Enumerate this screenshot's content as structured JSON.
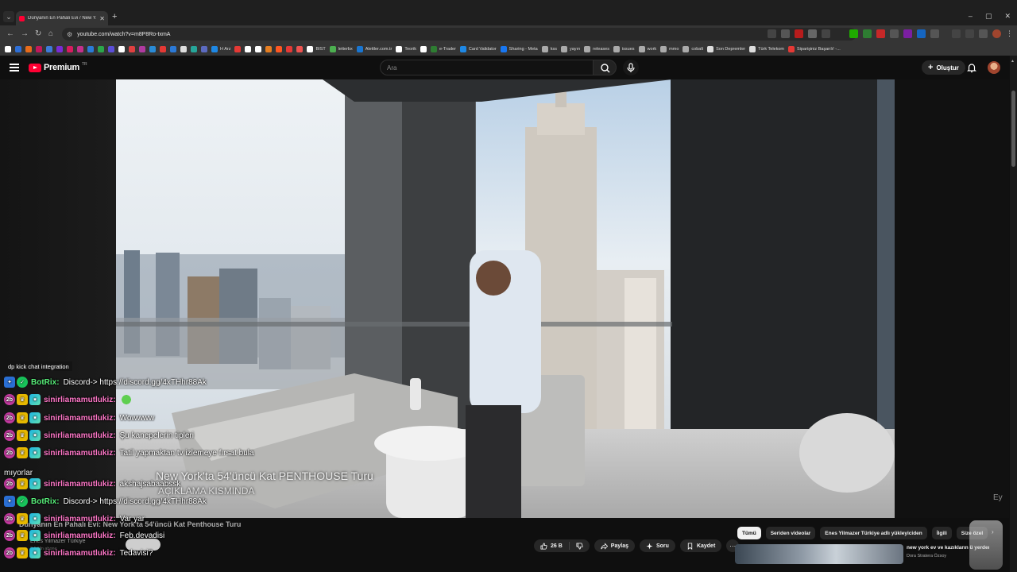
{
  "browser": {
    "tab_title": "Dünyanın En Pahalı Evi / New Y...",
    "tab_close": "✕",
    "new_tab": "+",
    "window_controls": [
      "–",
      "▢",
      "✕"
    ],
    "url": "youtube.com/watch?v=m8P8Ro-txmA",
    "bookmarks": [
      {
        "label": "",
        "color": "#ffffff"
      },
      {
        "label": "",
        "color": "#2e6fd6"
      },
      {
        "label": "",
        "color": "#e86b1a"
      },
      {
        "label": "",
        "color": "#c2185b"
      },
      {
        "label": "",
        "color": "#3d7bd9"
      },
      {
        "label": "",
        "color": "#7a2bd6"
      },
      {
        "label": "",
        "color": "#d81b60"
      },
      {
        "label": "",
        "color": "#c4308c"
      },
      {
        "label": "",
        "color": "#2a7bd8"
      },
      {
        "label": "",
        "color": "#2ba64a"
      },
      {
        "label": "",
        "color": "#5b4ed8"
      },
      {
        "label": "",
        "color": "#ffffff"
      },
      {
        "label": "",
        "color": "#e04040"
      },
      {
        "label": "",
        "color": "#b03aa0"
      },
      {
        "label": "",
        "color": "#2a8bd6"
      },
      {
        "label": "",
        "color": "#e53935"
      },
      {
        "label": "",
        "color": "#2b79d6"
      },
      {
        "label": "",
        "color": "#dddddd"
      },
      {
        "label": "",
        "color": "#26a69a"
      },
      {
        "label": "",
        "color": "#5c6bc0"
      },
      {
        "label": "H Arz",
        "color": "#1e88e5"
      },
      {
        "label": "",
        "color": "#e53935"
      },
      {
        "label": "",
        "color": "#ffffff"
      },
      {
        "label": "",
        "color": "#ffffff"
      },
      {
        "label": "",
        "color": "#e67e22"
      },
      {
        "label": "",
        "color": "#ff5722"
      },
      {
        "label": "",
        "color": "#e53935"
      },
      {
        "label": "",
        "color": "#ef5350"
      },
      {
        "label": "BIST",
        "color": "#ffffff"
      },
      {
        "label": "letterbx",
        "color": "#4caf50"
      },
      {
        "label": "Alettler.com.tr",
        "color": "#1976d2"
      },
      {
        "label": "Teorik",
        "color": "#ffffff"
      },
      {
        "label": "",
        "color": "#ffffff"
      },
      {
        "label": "e-Trader",
        "color": "#2e7d32"
      },
      {
        "label": "Card Validator",
        "color": "#1e88e5"
      },
      {
        "label": "Sharing - Meta",
        "color": "#1877f2"
      },
      {
        "label": "kss",
        "color": "#aaaaaa"
      },
      {
        "label": "yayın",
        "color": "#aaaaaa"
      },
      {
        "label": "releases",
        "color": "#aaaaaa"
      },
      {
        "label": "issues",
        "color": "#aaaaaa"
      },
      {
        "label": "work",
        "color": "#aaaaaa"
      },
      {
        "label": "mmo",
        "color": "#aaaaaa"
      },
      {
        "label": "cobalt",
        "color": "#aaaaaa"
      },
      {
        "label": "Son Depremler",
        "color": "#dddddd"
      },
      {
        "label": "Türk Telekom",
        "color": "#dddddd"
      },
      {
        "label": "Siparişiniz Başarılı! -...",
        "color": "#e53935"
      }
    ]
  },
  "youtube": {
    "logo_text": "Premium",
    "logo_region": "TR",
    "search_placeholder": "Ara",
    "create_label": "Oluştur",
    "create_icon": "+"
  },
  "video": {
    "subtitle_line1": "New York'ta 54'üncü Kat PENTHOUSE Turu",
    "subtitle_line2": "AÇIKLAMA KISMINDA",
    "watermark": "Ey"
  },
  "chat": {
    "label": "dp kick chat integration",
    "lines": [
      {
        "user": "BotRix:",
        "kind": "bot",
        "msg": "Discord-> https://discord.gg/4xTHhr88Ak",
        "emote": false
      },
      {
        "user": "sinirliamamutlukiz:",
        "kind": "user",
        "msg": "",
        "emote": true
      },
      {
        "user": "sinirliamamutlukiz:",
        "kind": "user",
        "msg": "Wowwww",
        "emote": false
      },
      {
        "user": "sinirliamamutlukiz:",
        "kind": "user",
        "msg": "Şu kanepelerin tipleri",
        "emote": false
      },
      {
        "user": "sinirliamamutlukiz:",
        "kind": "user",
        "msg": "Tatil yapmaktan tv izlemeye fırsat bula",
        "emote": false
      },
      {
        "user": "sinirliamamutlukiz:",
        "kind": "user",
        "msg": "akshajsabaabssk",
        "emote": false
      },
      {
        "user": "BotRix:",
        "kind": "bot",
        "msg": "Discord-> https://discord.gg/4xTHhr88Ak",
        "emote": false
      },
      {
        "user": "sinirliamamutlukiz:",
        "kind": "user",
        "msg": "Var yar",
        "emote": false
      },
      {
        "user": "sinirliamamutlukiz:",
        "kind": "user",
        "msg": "Feb.devadisi",
        "emote": false
      },
      {
        "user": "sinirliamamutlukiz:",
        "kind": "user",
        "msg": "Tedavisi?",
        "emote": false
      }
    ],
    "wrap_text": "mıyorlar",
    "sub_badge": "2b"
  },
  "below": {
    "title": "Dünyanın En Pahalı Evi: New York'ta 54'üncü Kat Penthouse Turu",
    "channel": "Enes Yilmazer Türkiye",
    "subs": "2,5 Mn abone",
    "like_count": "26 B",
    "share_label": "Paylaş",
    "ask_label": "Soru",
    "save_label": "Kaydet",
    "more_label": "···"
  },
  "chips": [
    "Tümü",
    "Seriden videolar",
    "Enes Yilmazer Türkiye adlı yükleyiciden",
    "İlgili",
    "Size özel"
  ],
  "recommendation": {
    "title": "new york ev ve kazıkların ü yerden",
    "channel": "Dora Stratera Özsoy"
  }
}
